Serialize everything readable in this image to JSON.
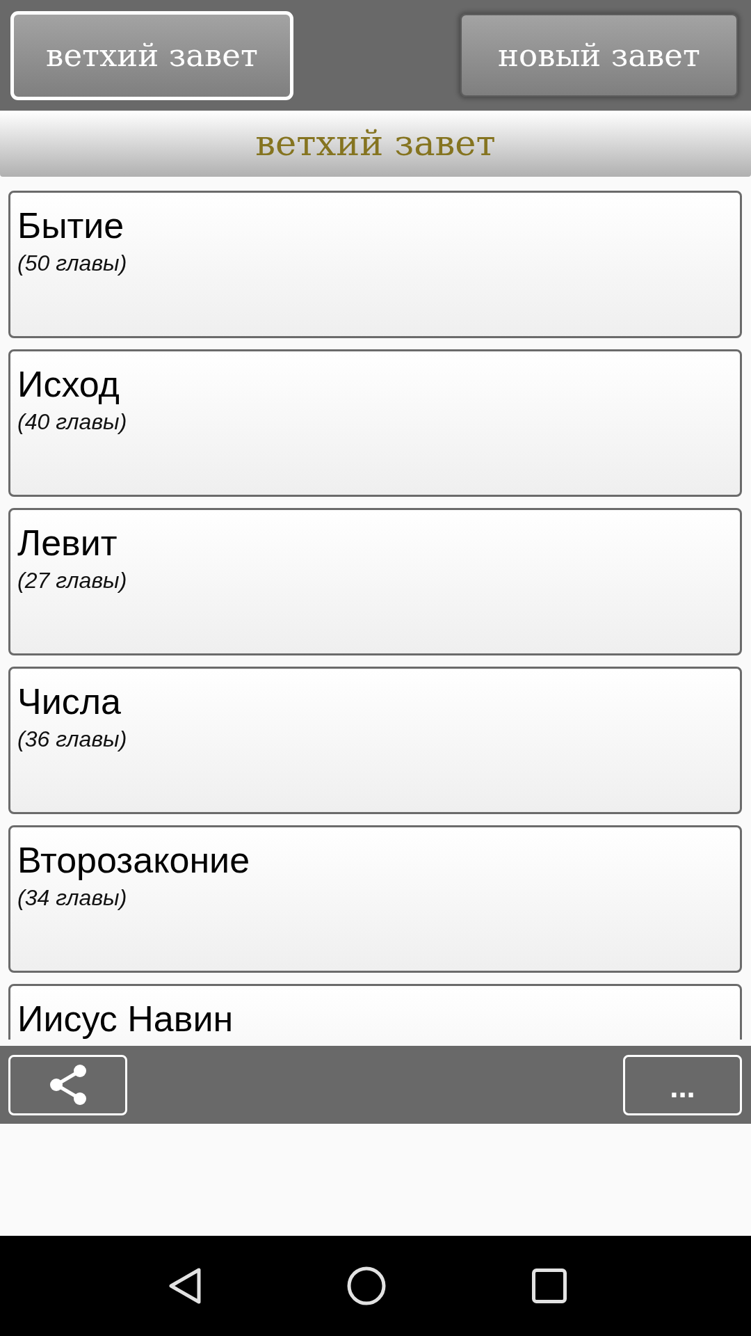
{
  "testament_tabs": [
    {
      "label": "ветхий завет",
      "selected": true
    },
    {
      "label": "новый завет",
      "selected": false
    }
  ],
  "section_title": "ветхий завет",
  "books": [
    {
      "title": "Бытие",
      "chapters": "(50 главы)"
    },
    {
      "title": "Исход",
      "chapters": "(40 главы)"
    },
    {
      "title": "Левит",
      "chapters": "(27 главы)"
    },
    {
      "title": "Числа",
      "chapters": "(36 главы)"
    },
    {
      "title": "Второзаконие",
      "chapters": "(34 главы)"
    },
    {
      "title": "Иисус Навин"
    }
  ],
  "toolbar": {
    "more_label": "..."
  }
}
